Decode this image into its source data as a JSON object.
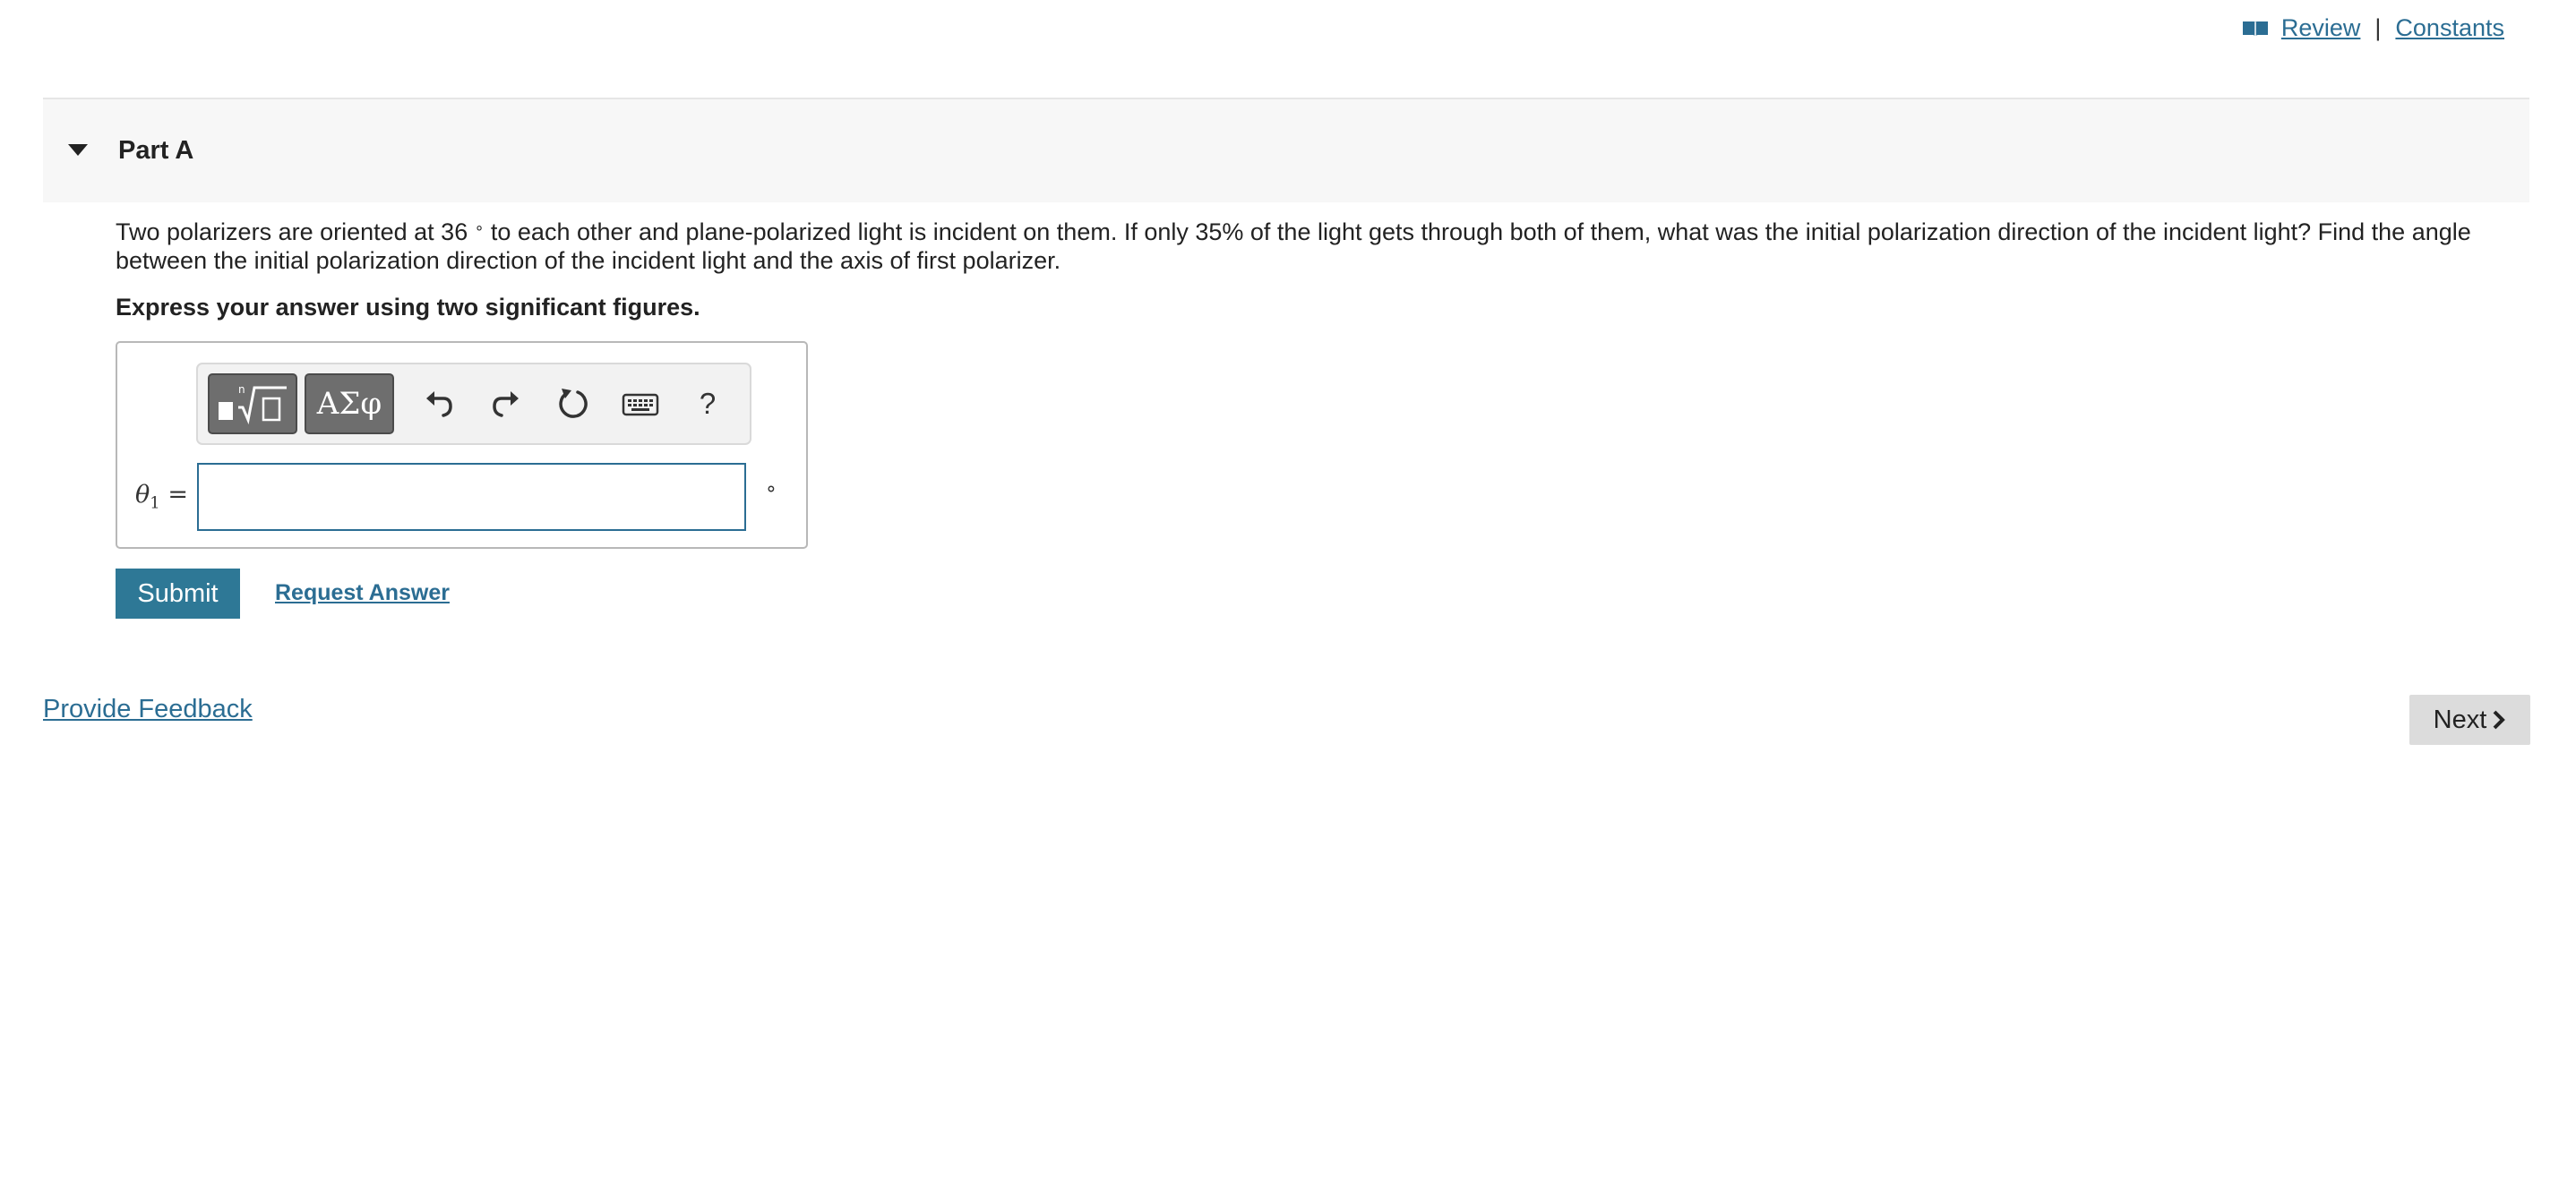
{
  "header": {
    "review_label": "Review",
    "separator": "|",
    "constants_label": "Constants"
  },
  "part": {
    "title": "Part A"
  },
  "question": {
    "text_before": "Two polarizers are oriented at 36",
    "degree_symbol": "∘",
    "text_after": " to each other and plane-polarized light is incident on them. If only 35% of the light gets through both of them, what was the initial polarization direction of the incident light? Find the angle between the initial polarization direction of the incident light and the axis of first polarizer."
  },
  "instruction": "Express your answer using two significant figures.",
  "answer": {
    "variable": "θ",
    "subscript": "1",
    "equals": "=",
    "value": "",
    "unit": "∘"
  },
  "toolbar": {
    "greek_label": "ΑΣφ",
    "help_label": "?",
    "icons": [
      "templates-icon",
      "greek-icon",
      "undo-icon",
      "redo-icon",
      "reset-icon",
      "keyboard-icon",
      "help-icon"
    ]
  },
  "actions": {
    "submit_label": "Submit",
    "request_answer_label": "Request Answer",
    "provide_feedback_label": "Provide Feedback",
    "next_label": "Next"
  },
  "colors": {
    "link": "#2b6d93",
    "submit_bg": "#2e7896",
    "next_bg": "#dcdcdc",
    "part_header_bg": "#f7f7f7",
    "toolbar_button_bg": "#6e6e6e"
  }
}
